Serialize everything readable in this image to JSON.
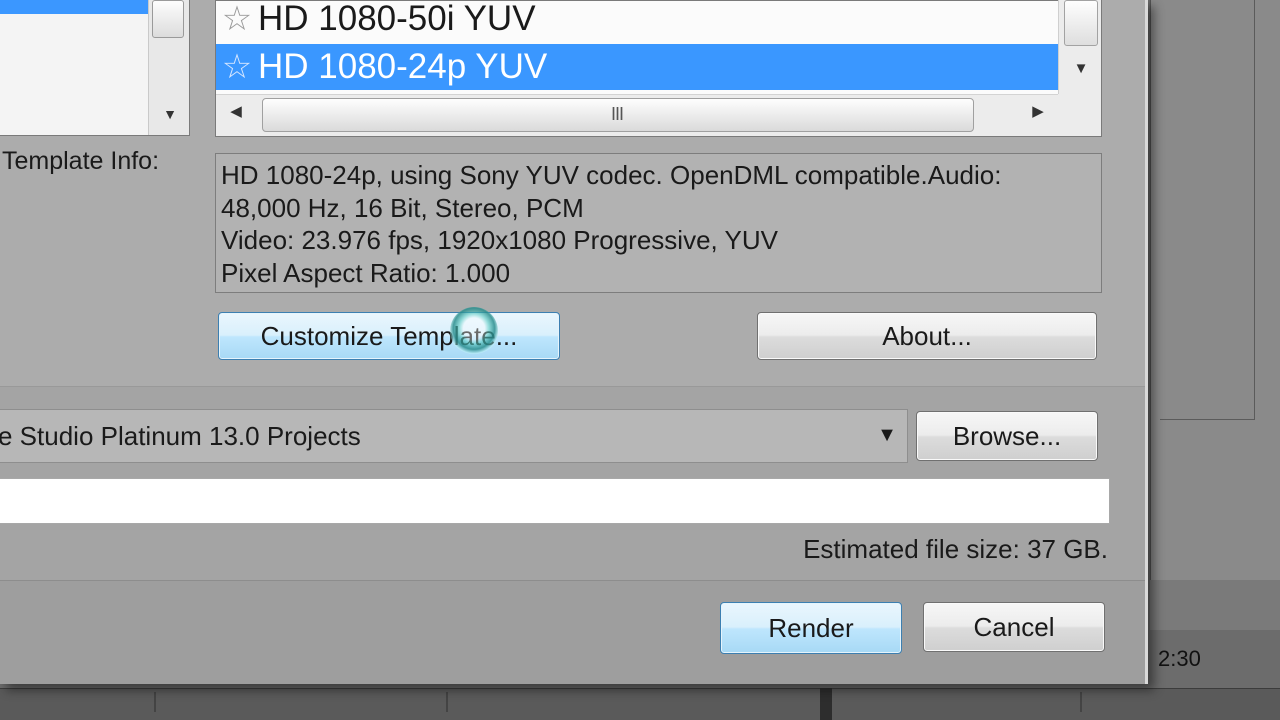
{
  "template_list": {
    "items": [
      {
        "label": "HD 1080-50i YUV",
        "selected": false
      },
      {
        "label": "HD 1080-24p YUV",
        "selected": true
      }
    ]
  },
  "template_info": {
    "label": "Template Info:",
    "lines": [
      "HD 1080-24p, using Sony YUV codec. OpenDML compatible.Audio:",
      "48,000 Hz, 16 Bit, Stereo, PCM",
      "Video: 23.976 fps, 1920x1080 Progressive, YUV",
      "Pixel Aspect Ratio: 1.000"
    ]
  },
  "buttons": {
    "customize": "Customize Template...",
    "about": "About...",
    "browse": "Browse...",
    "render": "Render",
    "cancel": "Cancel"
  },
  "folder": {
    "value": "e Studio Platinum 13.0 Projects"
  },
  "name_field": {
    "value": ""
  },
  "estimated_size": "Estimated file size: 37 GB.",
  "background": {
    "time_readout": "2:30"
  },
  "icons": {
    "favorite": "star-outline-icon",
    "scroll_left": "chevron-left-icon",
    "scroll_right": "chevron-right-icon",
    "scroll_down": "chevron-down-icon",
    "dropdown": "dropdown-arrow-icon"
  },
  "colors": {
    "selection": "#3a97ff",
    "dialog_bg": "#a9a9a9",
    "button_focus": "#bee6fd"
  }
}
